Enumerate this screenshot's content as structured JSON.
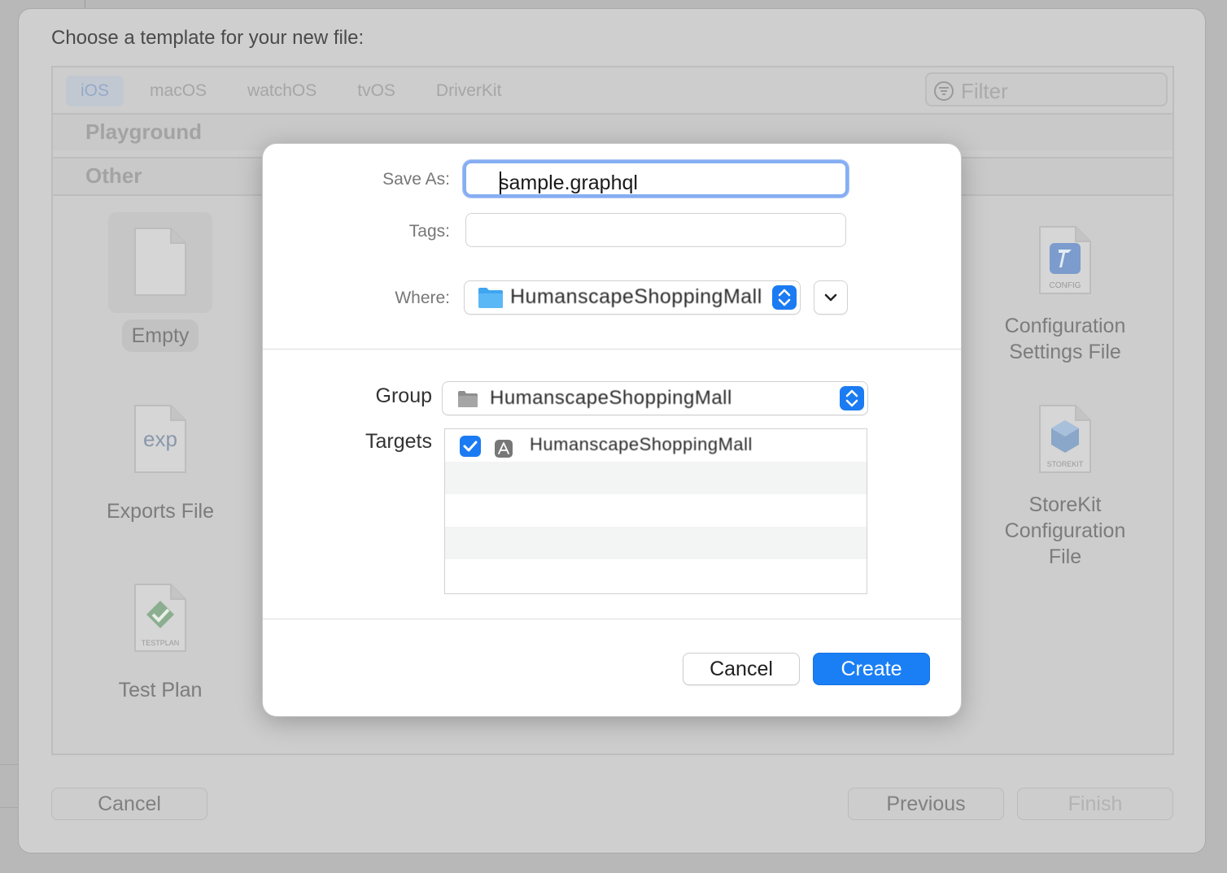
{
  "sheet": {
    "title": "Choose a template for your new file:",
    "tabs": [
      "iOS",
      "macOS",
      "watchOS",
      "tvOS",
      "DriverKit"
    ],
    "filter_placeholder": "Filter",
    "sections": [
      "Playground",
      "Other"
    ],
    "templates": [
      {
        "label": "Empty",
        "icon": "blank-document-icon",
        "selected": true
      },
      {
        "label": "Exports File",
        "icon": "exp-document-icon",
        "glyph": "exp"
      },
      {
        "label": "Test Plan",
        "icon": "testplan-document-icon",
        "badge": "TESTPLAN"
      },
      {
        "label": "Configuration\nSettings File",
        "icon": "config-document-icon",
        "badge": "CONFIG"
      },
      {
        "label": "StoreKit\nConfiguration File",
        "icon": "storekit-document-icon",
        "badge": "STOREKIT"
      }
    ],
    "buttons": {
      "cancel": "Cancel",
      "previous": "Previous",
      "finish": "Finish"
    }
  },
  "dialog": {
    "save_as_label": "Save As:",
    "save_as_value": "sample.graphql",
    "tags_label": "Tags:",
    "tags_value": "",
    "where_label": "Where:",
    "where_value": "HumanscapeShoppingMall",
    "group_label": "Group",
    "group_value": "HumanscapeShoppingMall",
    "targets_label": "Targets",
    "targets": [
      {
        "name": "HumanscapeShoppingMall",
        "checked": true
      }
    ],
    "cancel_label": "Cancel",
    "create_label": "Create"
  },
  "colors": {
    "accent": "#1a7ff5",
    "focus_ring": "#86aef2"
  }
}
